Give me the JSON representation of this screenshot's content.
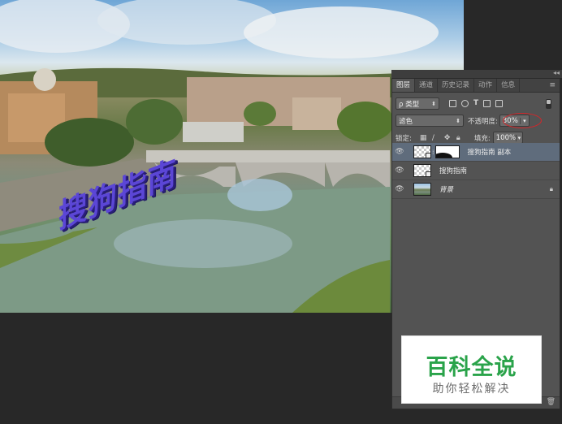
{
  "watermark_text": "搜狗指南",
  "layers_panel": {
    "tabs": [
      "图层",
      "通道",
      "历史记录",
      "动作",
      "信息"
    ],
    "filter_label": "ρ 类型",
    "blend_mode": "滤色",
    "opacity_label": "不透明度:",
    "opacity_value": "30%",
    "lock_label": "锁定:",
    "fill_label": "填充:",
    "fill_value": "100%",
    "layers": [
      {
        "name": "搜狗指南 副本",
        "selected": true
      },
      {
        "name": "搜狗指南",
        "selected": false
      },
      {
        "name": "背景",
        "selected": false
      }
    ]
  },
  "logo": {
    "title": "百科全说",
    "subtitle": "助你轻松解决"
  },
  "colors": {
    "panel_bg": "#535353",
    "selected_row": "#5f6c7c",
    "highlight_ring": "#d4262a",
    "logo_green": "#2aa34a",
    "watermark_purple": "#5b46d6"
  },
  "icons": [
    "eye-icon",
    "lock-icon",
    "trash-icon",
    "chain-link-icon",
    "panel-menu-icon"
  ]
}
